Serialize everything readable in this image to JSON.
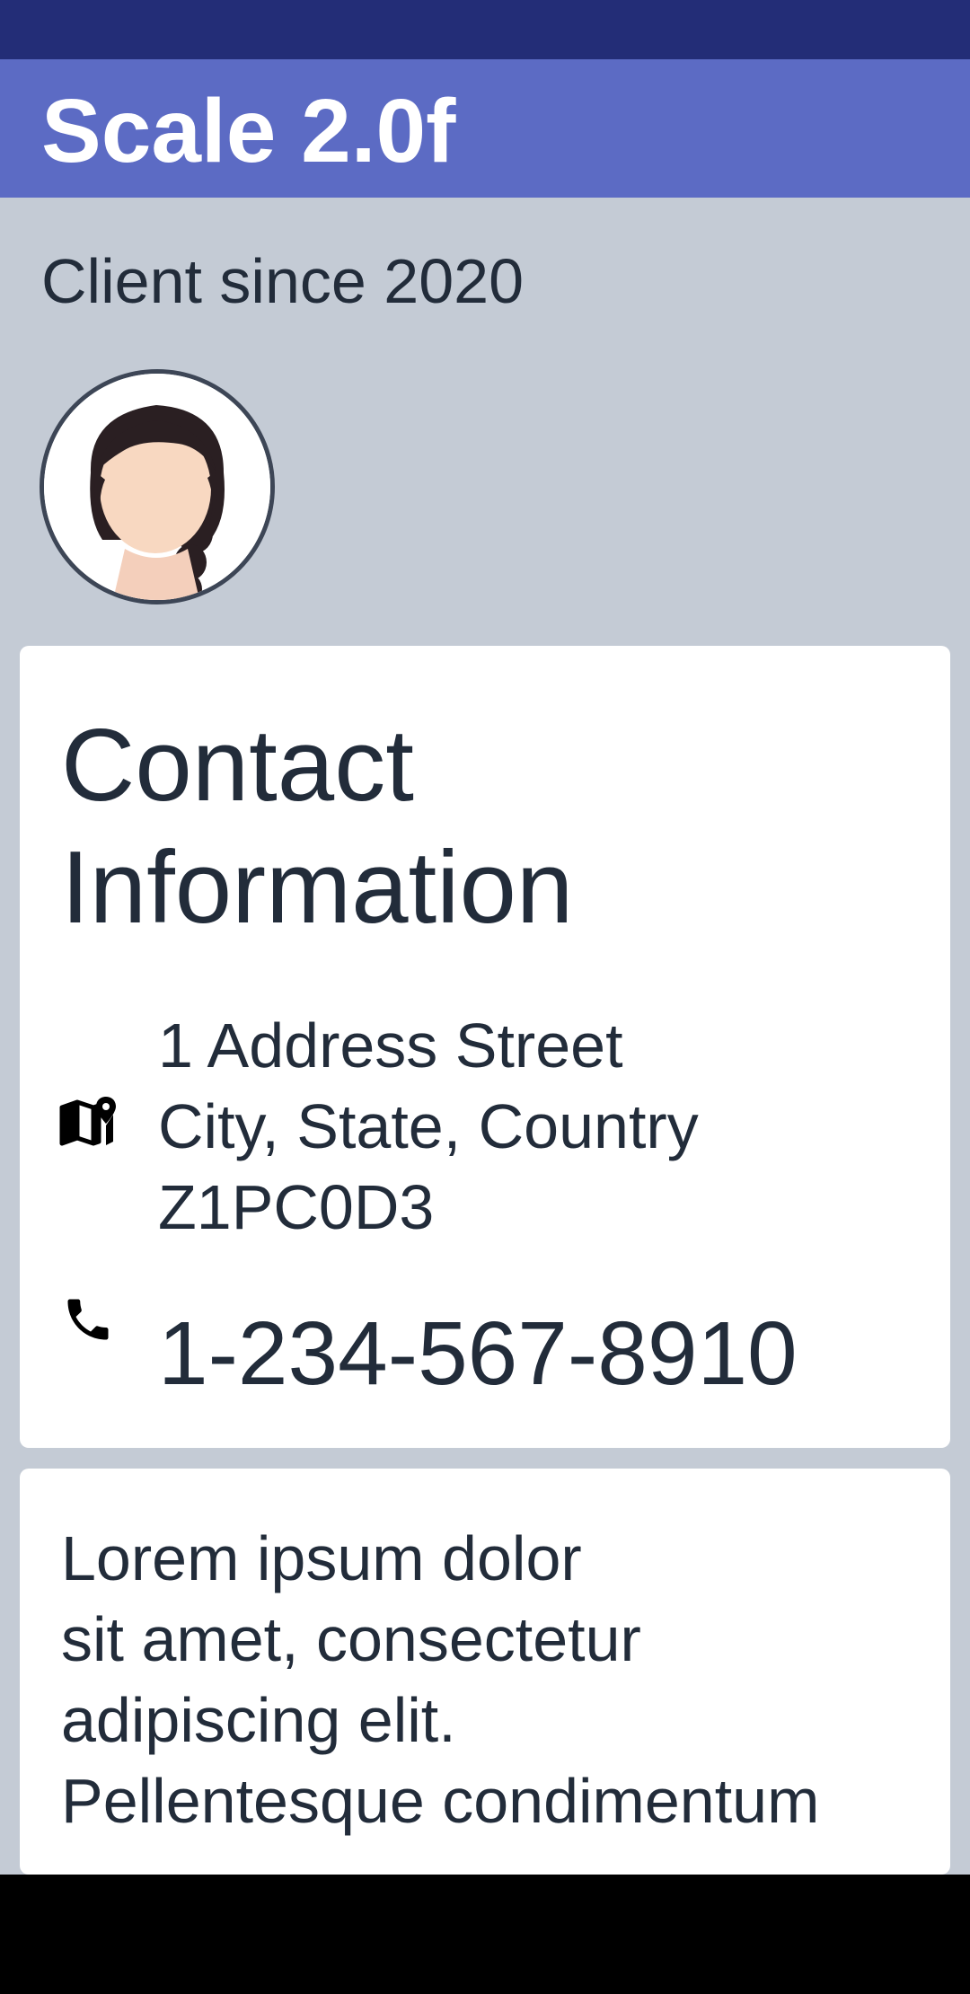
{
  "app_bar": {
    "title": "Scale 2.0f"
  },
  "profile": {
    "client_since": "Client since 2020",
    "avatar_icon": "avatar-woman-icon"
  },
  "contact": {
    "title_lines": [
      "Contact",
      "Information"
    ],
    "address_icon": "map-icon",
    "address_lines": [
      "1 Address Street",
      "City, State, Country",
      "Z1PC0D3"
    ],
    "phone_icon": "phone-icon",
    "phone": "1-234-567-8910"
  },
  "about": {
    "lines": [
      "Lorem ipsum dolor",
      "sit amet, consectetur",
      "adipiscing elit.",
      "Pellentesque condimentum"
    ]
  },
  "colors": {
    "status_bar": "#232d77",
    "app_bar": "#5c6bc4",
    "background": "#c4cbd5",
    "card": "#ffffff",
    "text": "#222c3a"
  }
}
